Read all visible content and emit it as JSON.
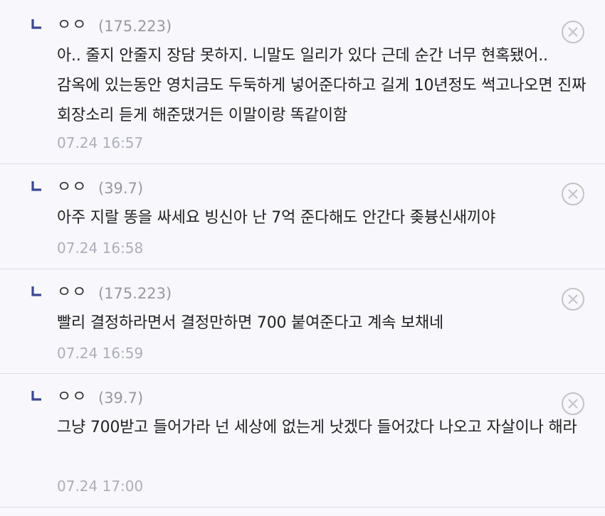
{
  "comments": [
    {
      "nickname": "ㅇㅇ",
      "ip": "(175.223)",
      "text": "아.. 줄지 안줄지 장담 못하지. 니말도 일리가 있다 근데 순간 너무 현혹됐어.. 감옥에 있는동안 영치금도 두둑하게 넣어준다하고 길게 10년정도 썩고나오면 진짜 회장소리 듣게 해준댔거든 이말이랑 똑같이함",
      "date": "07.24 16:57"
    },
    {
      "nickname": "ㅇㅇ",
      "ip": "(39.7)",
      "text": "아주 지랄 똥을 싸세요 빙신아 난 7억 준다해도 안간다 좆븅신새끼야",
      "date": "07.24 16:58"
    },
    {
      "nickname": "ㅇㅇ",
      "ip": "(175.223)",
      "text": "빨리 결정하라면서 결정만하면 700 붙여준다고 계속 보채네",
      "date": "07.24 16:59"
    },
    {
      "nickname": "ㅇㅇ",
      "ip": "(39.7)",
      "text": "그냥 700받고 들어가라 넌 세상에 없는게 낫겠다 들어갔다 나오고 자살이나 해라",
      "date": "07.24 17:00"
    }
  ],
  "icons": {
    "reply": "reply-arrow-icon",
    "delete": "close-circle-icon"
  },
  "colors": {
    "background": "#f7f7fc",
    "reply_mark": "#3b4890",
    "divider": "#dcdcea",
    "ip_text": "#9a9a9a",
    "date_text": "#aeaeb8"
  }
}
